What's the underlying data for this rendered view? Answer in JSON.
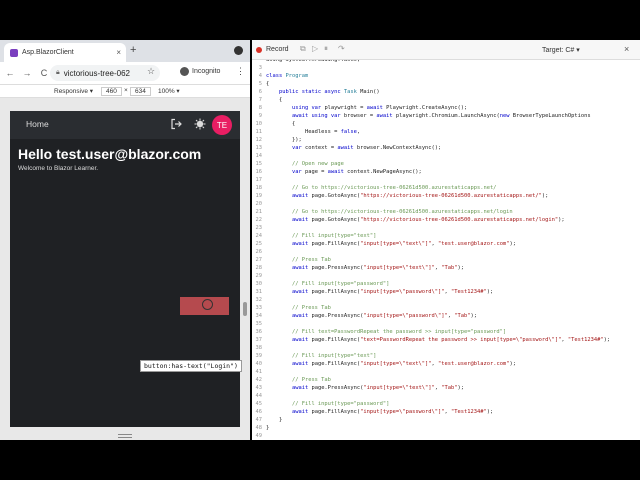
{
  "browser": {
    "tab_title": "Asp.BlazorClient",
    "tab_close": "×",
    "new_tab": "+",
    "back": "←",
    "forward": "→",
    "reload": "C",
    "url": "victorious-tree-062",
    "incognito": "Incognito",
    "devbar": {
      "device": "Responsive ▾",
      "width": "460",
      "times": "×",
      "height": "634",
      "zoom": "100% ▾"
    }
  },
  "app": {
    "nav_home": "Home",
    "avatar_initials": "TE",
    "hello": "Hello test.user@blazor.com",
    "welcome": "Welcome to Blazor Learner.",
    "tooltip": "button:has-text(\"Login\")"
  },
  "inspector": {
    "record_label": "Record",
    "target": "Target: C# ▾",
    "close": "×"
  },
  "code_lines": [
    {
      "n": "",
      "parts": [
        [
          "pl",
          "using System.Threading.Tasks;"
        ]
      ]
    },
    {
      "n": "3",
      "parts": [
        [
          "pl",
          ""
        ]
      ]
    },
    {
      "n": "4",
      "parts": [
        [
          "kw",
          "class "
        ],
        [
          "ty",
          "Program"
        ]
      ]
    },
    {
      "n": "5",
      "parts": [
        [
          "pl",
          "{"
        ]
      ]
    },
    {
      "n": "6",
      "parts": [
        [
          "pl",
          "    "
        ],
        [
          "kw",
          "public static async "
        ],
        [
          "ty",
          "Task "
        ],
        [
          "pl",
          "Main()"
        ]
      ]
    },
    {
      "n": "7",
      "parts": [
        [
          "pl",
          "    {"
        ]
      ]
    },
    {
      "n": "8",
      "parts": [
        [
          "pl",
          "        "
        ],
        [
          "kw",
          "using var "
        ],
        [
          "pl",
          "playwright = "
        ],
        [
          "kw",
          "await "
        ],
        [
          "pl",
          "Playwright.CreateAsync();"
        ]
      ]
    },
    {
      "n": "9",
      "parts": [
        [
          "pl",
          "        "
        ],
        [
          "kw",
          "await using var "
        ],
        [
          "pl",
          "browser = "
        ],
        [
          "kw",
          "await "
        ],
        [
          "pl",
          "playwright.Chromium.LaunchAsync("
        ],
        [
          "kw",
          "new "
        ],
        [
          "pl",
          "BrowserTypeLaunchOptions"
        ]
      ]
    },
    {
      "n": "10",
      "parts": [
        [
          "pl",
          "        {"
        ]
      ]
    },
    {
      "n": "11",
      "parts": [
        [
          "pl",
          "            Headless = "
        ],
        [
          "kw",
          "false"
        ],
        [
          "pl",
          ","
        ]
      ]
    },
    {
      "n": "12",
      "parts": [
        [
          "pl",
          "        });"
        ]
      ]
    },
    {
      "n": "13",
      "parts": [
        [
          "pl",
          "        "
        ],
        [
          "kw",
          "var "
        ],
        [
          "pl",
          "context = "
        ],
        [
          "kw",
          "await "
        ],
        [
          "pl",
          "browser.NewContextAsync();"
        ]
      ]
    },
    {
      "n": "14",
      "parts": [
        [
          "pl",
          ""
        ]
      ]
    },
    {
      "n": "15",
      "parts": [
        [
          "pl",
          "        "
        ],
        [
          "cm",
          "// Open new page"
        ]
      ]
    },
    {
      "n": "16",
      "parts": [
        [
          "pl",
          "        "
        ],
        [
          "kw",
          "var "
        ],
        [
          "pl",
          "page = "
        ],
        [
          "kw",
          "await "
        ],
        [
          "pl",
          "context.NewPageAsync();"
        ]
      ]
    },
    {
      "n": "17",
      "parts": [
        [
          "pl",
          ""
        ]
      ]
    },
    {
      "n": "18",
      "parts": [
        [
          "pl",
          "        "
        ],
        [
          "cm",
          "// Go to https://victorious-tree-06261d500.azurestaticapps.net/"
        ]
      ]
    },
    {
      "n": "19",
      "parts": [
        [
          "pl",
          "        "
        ],
        [
          "kw",
          "await "
        ],
        [
          "pl",
          "page.GotoAsync("
        ],
        [
          "str",
          "\"https://victorious-tree-06261d500.azurestaticapps.net/\""
        ],
        [
          "pl",
          ");"
        ]
      ]
    },
    {
      "n": "20",
      "parts": [
        [
          "pl",
          ""
        ]
      ]
    },
    {
      "n": "21",
      "parts": [
        [
          "pl",
          "        "
        ],
        [
          "cm",
          "// Go to https://victorious-tree-06261d500.azurestaticapps.net/login"
        ]
      ]
    },
    {
      "n": "22",
      "parts": [
        [
          "pl",
          "        "
        ],
        [
          "kw",
          "await "
        ],
        [
          "pl",
          "page.GotoAsync("
        ],
        [
          "str",
          "\"https://victorious-tree-06261d500.azurestaticapps.net/login\""
        ],
        [
          "pl",
          ");"
        ]
      ]
    },
    {
      "n": "23",
      "parts": [
        [
          "pl",
          ""
        ]
      ]
    },
    {
      "n": "24",
      "parts": [
        [
          "pl",
          "        "
        ],
        [
          "cm",
          "// Fill input[type=\"text\"]"
        ]
      ]
    },
    {
      "n": "25",
      "parts": [
        [
          "pl",
          "        "
        ],
        [
          "kw",
          "await "
        ],
        [
          "pl",
          "page.FillAsync("
        ],
        [
          "str",
          "\"input[type=\\\"text\\\"]\""
        ],
        [
          "pl",
          ", "
        ],
        [
          "str",
          "\"test.user@blazor.com\""
        ],
        [
          "pl",
          ");"
        ]
      ]
    },
    {
      "n": "26",
      "parts": [
        [
          "pl",
          ""
        ]
      ]
    },
    {
      "n": "27",
      "parts": [
        [
          "pl",
          "        "
        ],
        [
          "cm",
          "// Press Tab"
        ]
      ]
    },
    {
      "n": "28",
      "parts": [
        [
          "pl",
          "        "
        ],
        [
          "kw",
          "await "
        ],
        [
          "pl",
          "page.PressAsync("
        ],
        [
          "str",
          "\"input[type=\\\"text\\\"]\""
        ],
        [
          "pl",
          ", "
        ],
        [
          "str",
          "\"Tab\""
        ],
        [
          "pl",
          ");"
        ]
      ]
    },
    {
      "n": "29",
      "parts": [
        [
          "pl",
          ""
        ]
      ]
    },
    {
      "n": "30",
      "parts": [
        [
          "pl",
          "        "
        ],
        [
          "cm",
          "// Fill input[type=\"password\"]"
        ]
      ]
    },
    {
      "n": "31",
      "parts": [
        [
          "pl",
          "        "
        ],
        [
          "kw",
          "await "
        ],
        [
          "pl",
          "page.FillAsync("
        ],
        [
          "str",
          "\"input[type=\\\"password\\\"]\""
        ],
        [
          "pl",
          ", "
        ],
        [
          "str",
          "\"Test1234#\""
        ],
        [
          "pl",
          ");"
        ]
      ]
    },
    {
      "n": "32",
      "parts": [
        [
          "pl",
          ""
        ]
      ]
    },
    {
      "n": "33",
      "parts": [
        [
          "pl",
          "        "
        ],
        [
          "cm",
          "// Press Tab"
        ]
      ]
    },
    {
      "n": "34",
      "parts": [
        [
          "pl",
          "        "
        ],
        [
          "kw",
          "await "
        ],
        [
          "pl",
          "page.PressAsync("
        ],
        [
          "str",
          "\"input[type=\\\"password\\\"]\""
        ],
        [
          "pl",
          ", "
        ],
        [
          "str",
          "\"Tab\""
        ],
        [
          "pl",
          ");"
        ]
      ]
    },
    {
      "n": "35",
      "parts": [
        [
          "pl",
          ""
        ]
      ]
    },
    {
      "n": "36",
      "parts": [
        [
          "pl",
          "        "
        ],
        [
          "cm",
          "// Fill text=PasswordRepeat the password >> input[type=\"password\"]"
        ]
      ]
    },
    {
      "n": "37",
      "parts": [
        [
          "pl",
          "        "
        ],
        [
          "kw",
          "await "
        ],
        [
          "pl",
          "page.FillAsync("
        ],
        [
          "str",
          "\"text=PasswordRepeat the password >> input[type=\\\"password\\\"]\""
        ],
        [
          "pl",
          ", "
        ],
        [
          "str",
          "\"Test1234#\""
        ],
        [
          "pl",
          ");"
        ]
      ]
    },
    {
      "n": "38",
      "parts": [
        [
          "pl",
          ""
        ]
      ]
    },
    {
      "n": "39",
      "parts": [
        [
          "pl",
          "        "
        ],
        [
          "cm",
          "// Fill input[type=\"text\"]"
        ]
      ]
    },
    {
      "n": "40",
      "parts": [
        [
          "pl",
          "        "
        ],
        [
          "kw",
          "await "
        ],
        [
          "pl",
          "page.FillAsync("
        ],
        [
          "str",
          "\"input[type=\\\"text\\\"]\""
        ],
        [
          "pl",
          ", "
        ],
        [
          "str",
          "\"test.user@blazor.com\""
        ],
        [
          "pl",
          ");"
        ]
      ]
    },
    {
      "n": "41",
      "parts": [
        [
          "pl",
          ""
        ]
      ]
    },
    {
      "n": "42",
      "parts": [
        [
          "pl",
          "        "
        ],
        [
          "cm",
          "// Press Tab"
        ]
      ]
    },
    {
      "n": "43",
      "parts": [
        [
          "pl",
          "        "
        ],
        [
          "kw",
          "await "
        ],
        [
          "pl",
          "page.PressAsync("
        ],
        [
          "str",
          "\"input[type=\\\"text\\\"]\""
        ],
        [
          "pl",
          ", "
        ],
        [
          "str",
          "\"Tab\""
        ],
        [
          "pl",
          ");"
        ]
      ]
    },
    {
      "n": "44",
      "parts": [
        [
          "pl",
          ""
        ]
      ]
    },
    {
      "n": "45",
      "parts": [
        [
          "pl",
          "        "
        ],
        [
          "cm",
          "// Fill input[type=\"password\"]"
        ]
      ]
    },
    {
      "n": "46",
      "parts": [
        [
          "pl",
          "        "
        ],
        [
          "kw",
          "await "
        ],
        [
          "pl",
          "page.FillAsync("
        ],
        [
          "str",
          "\"input[type=\\\"password\\\"]\""
        ],
        [
          "pl",
          ", "
        ],
        [
          "str",
          "\"Test1234#\""
        ],
        [
          "pl",
          ");"
        ]
      ]
    },
    {
      "n": "47",
      "parts": [
        [
          "pl",
          "    }"
        ]
      ]
    },
    {
      "n": "48",
      "parts": [
        [
          "pl",
          "}"
        ]
      ]
    },
    {
      "n": "49",
      "parts": [
        [
          "pl",
          ""
        ]
      ]
    }
  ]
}
